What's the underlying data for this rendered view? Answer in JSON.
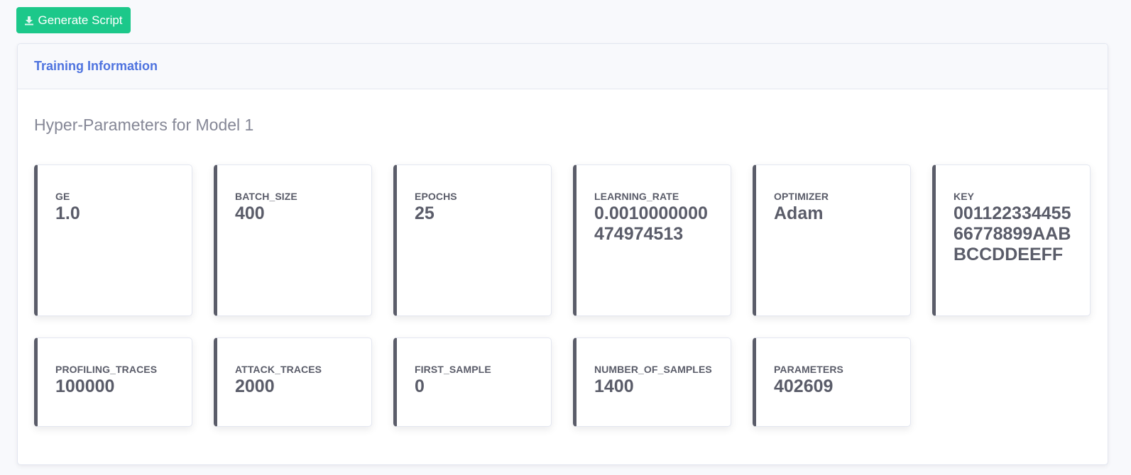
{
  "toolbar": {
    "generate_label": "Generate Script",
    "generate_icon": "download-icon",
    "generate_color": "#1cc88a"
  },
  "card": {
    "title": "Training Information",
    "section_title": "Hyper-Parameters for Model 1"
  },
  "params": [
    {
      "label": "GE",
      "value": "1.0"
    },
    {
      "label": "BATCH_SIZE",
      "value": "400"
    },
    {
      "label": "EPOCHS",
      "value": "25"
    },
    {
      "label": "LEARNING_RATE",
      "value": "0.0010000000474974513"
    },
    {
      "label": "OPTIMIZER",
      "value": "Adam"
    },
    {
      "label": "KEY",
      "value": "00112233445566778899AABBCCDDEEFF"
    },
    {
      "label": "PROFILING_TRACES",
      "value": "100000"
    },
    {
      "label": "ATTACK_TRACES",
      "value": "2000"
    },
    {
      "label": "FIRST_SAMPLE",
      "value": "0"
    },
    {
      "label": "NUMBER_OF_SAMPLES",
      "value": "1400"
    },
    {
      "label": "PARAMETERS",
      "value": "402609"
    }
  ],
  "colors": {
    "accent": "#4e73df",
    "card_border_left": "#5a5c69",
    "muted_text": "#858796"
  }
}
